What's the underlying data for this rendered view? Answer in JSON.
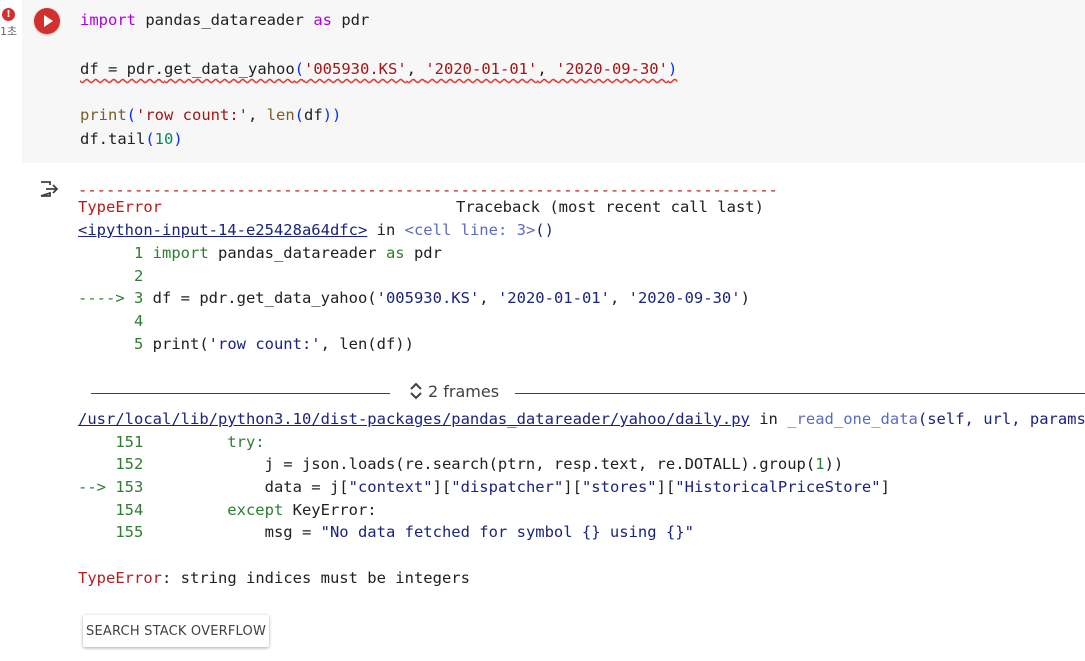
{
  "gutter": {
    "error_badge": "!",
    "exec_time": "1초"
  },
  "code_cell": {
    "line1": {
      "kw_import": "import",
      "mod": " pandas_datareader ",
      "kw_as": "as",
      "alias": " pdr"
    },
    "line2": {
      "prefix": "df = pdr.",
      "fn": "get_data_yahoo",
      "open": "(",
      "arg1": "'005930.KS'",
      "sep1": ", ",
      "arg2": "'2020-01-01'",
      "sep2": ", ",
      "arg3": "'2020-09-30'",
      "close": ")"
    },
    "line3": {
      "fn": "print",
      "open": "(",
      "str": "'row count:'",
      "sep": ", ",
      "len": "len",
      "open2": "(",
      "df": "df",
      "close2": "))"
    },
    "line4": {
      "prefix": "df.tail",
      "open": "(",
      "num": "10",
      "close": ")"
    }
  },
  "output": {
    "dashes": "---------------------------------------------------------------------------",
    "error_type": "TypeError",
    "traceback_header": "Traceback (most recent call last)",
    "input_link": "<ipython-input-14-e25428a64dfc>",
    "in_word": " in ",
    "cell_line": "<cell line: 3>",
    "cell_parens": "()",
    "tb1": {
      "l1_num": "      1 ",
      "l1_kw": "import",
      "l1_rest": " pandas_datareader ",
      "l1_as": "as",
      "l1_alias": " pdr",
      "l2_num": "      2",
      "l3_arrow": "----> 3 ",
      "l3_code": "df = pdr.get_data_yahoo(",
      "l3_a1": "'005930.KS'",
      "l3_s1": ", ",
      "l3_a2": "'2020-01-01'",
      "l3_s2": ", ",
      "l3_a3": "'2020-09-30'",
      "l3_close": ")",
      "l4_num": "      4",
      "l5_num": "      5 ",
      "l5_code": "print(",
      "l5_str": "'row count:'",
      "l5_rest": ", len(df))"
    },
    "frames_label": "2 frames",
    "file_link": "/usr/local/lib/python3.10/dist-packages/pandas_datareader/yahoo/daily.py",
    "file_in": " in ",
    "func_name": "_read_one_data",
    "func_args": "(self, url, params)",
    "tb2": {
      "l151_num": "    151 ",
      "l151_code": "        try:",
      "l152_num": "    152 ",
      "l152_code": "            j = json.loads(re.search(ptrn, resp.text, re.DOTALL).group(",
      "l152_num_arg": "1",
      "l152_close": "))",
      "l153_arrow": "--> 153 ",
      "l153_code": "            data = j[",
      "l153_s1": "\"context\"",
      "l153_b1": "][",
      "l153_s2": "\"dispatcher\"",
      "l153_b2": "][",
      "l153_s3": "\"stores\"",
      "l153_b3": "][",
      "l153_s4": "\"HistoricalPriceStore\"",
      "l153_b4": "]",
      "l154_num": "    154 ",
      "l154_kw": "        except",
      "l154_rest": " KeyError:",
      "l155_num": "    155 ",
      "l155_code": "            msg = ",
      "l155_str": "\"No data fetched for symbol {} using {}\""
    },
    "final_error_type": "TypeError",
    "final_error_msg": ": string indices must be integers"
  },
  "search_button": {
    "label": "SEARCH STACK OVERFLOW"
  }
}
